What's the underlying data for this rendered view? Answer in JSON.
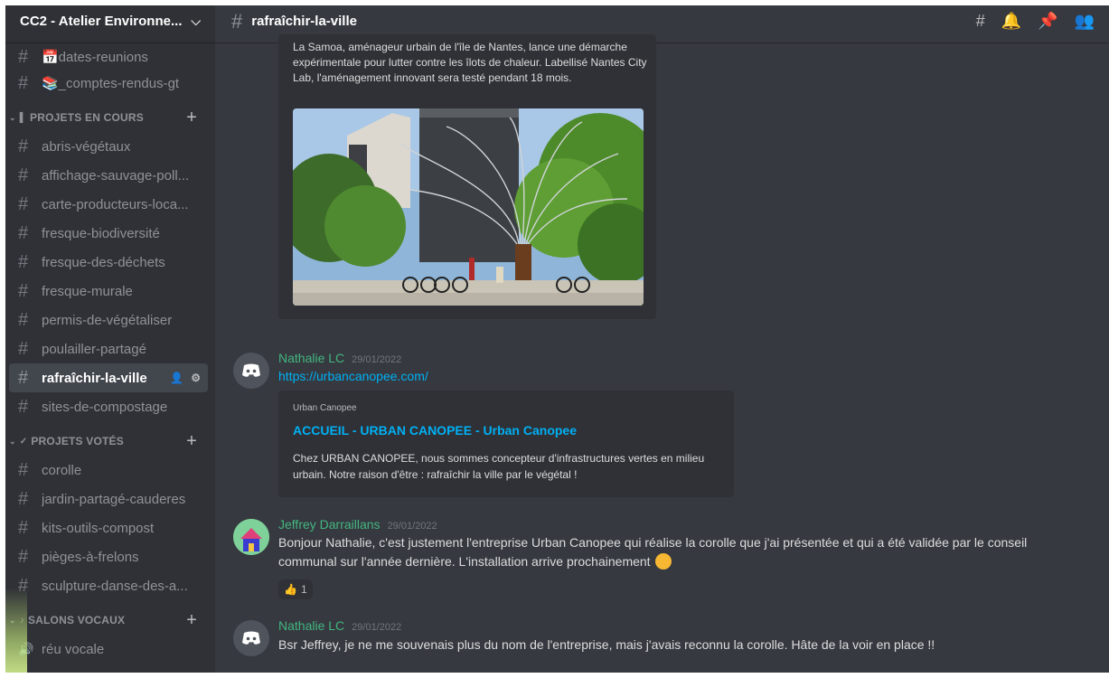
{
  "server": {
    "name": "CC2 - Atelier Environne..."
  },
  "sidebar": {
    "top_channels": [
      {
        "label": "📅dates-reunions"
      },
      {
        "label": "📚_comptes-rendus-gt"
      }
    ],
    "categories": [
      {
        "title": "PROJETS EN COURS",
        "channels": [
          "abris-végétaux",
          "affichage-sauvage-poll...",
          "carte-producteurs-loca...",
          "fresque-biodiversité",
          "fresque-des-déchets",
          "fresque-murale",
          "permis-de-végétaliser",
          "poulailler-partagé",
          "rafraîchir-la-ville",
          "sites-de-compostage"
        ]
      },
      {
        "title": "PROJETS VOTÉS",
        "channels": [
          "corolle",
          "jardin-partagé-cauderes",
          "kits-outils-compost",
          "pièges-à-frelons",
          "sculpture-danse-des-a..."
        ]
      },
      {
        "title": "SALONS VOCAUX",
        "channels": [
          "réu vocale"
        ]
      }
    ]
  },
  "channel": {
    "name": "rafraîchir-la-ville"
  },
  "messages": {
    "embed_top": {
      "description": "La Samoa, aménageur urbain de l'île de Nantes, lance une démarche expérimentale pour lutter contre les îlots de chaleur. Labellisé Nantes City Lab, l'aménagement innovant sera testé pendant 18 mois."
    },
    "m1": {
      "author": "Nathalie LC",
      "timestamp": "29/01/2022",
      "link": "https://urbancanopee.com/",
      "embed": {
        "provider": "Urban Canopee",
        "title": "ACCUEIL - URBAN CANOPEE - Urban Canopee",
        "description": "Chez URBAN CANOPEE, nous sommes concepteur d'infrastructures vertes en milieu urbain. Notre raison d'être : rafraîchir la ville par le végétal !"
      }
    },
    "m2": {
      "author": "Jeffrey Darraillans",
      "timestamp": "29/01/2022",
      "text": "Bonjour Nathalie, c'est justement l'entreprise Urban Canopee qui réalise la corolle que j'ai présentée et qui a été validée par le conseil communal sur l'année dernière. L'installation arrive prochainement",
      "reaction_count": "1"
    },
    "m3": {
      "author": "Nathalie LC",
      "timestamp": "29/01/2022",
      "text": "Bsr Jeffrey, je ne me souvenais plus du nom de l'entreprise, mais j'avais reconnu la corolle. Hâte de la voir en place !!"
    }
  },
  "colors": {
    "username": "#43b581",
    "link": "#00b0f4",
    "sidebar": "#2f3136",
    "chat": "#36393f"
  }
}
